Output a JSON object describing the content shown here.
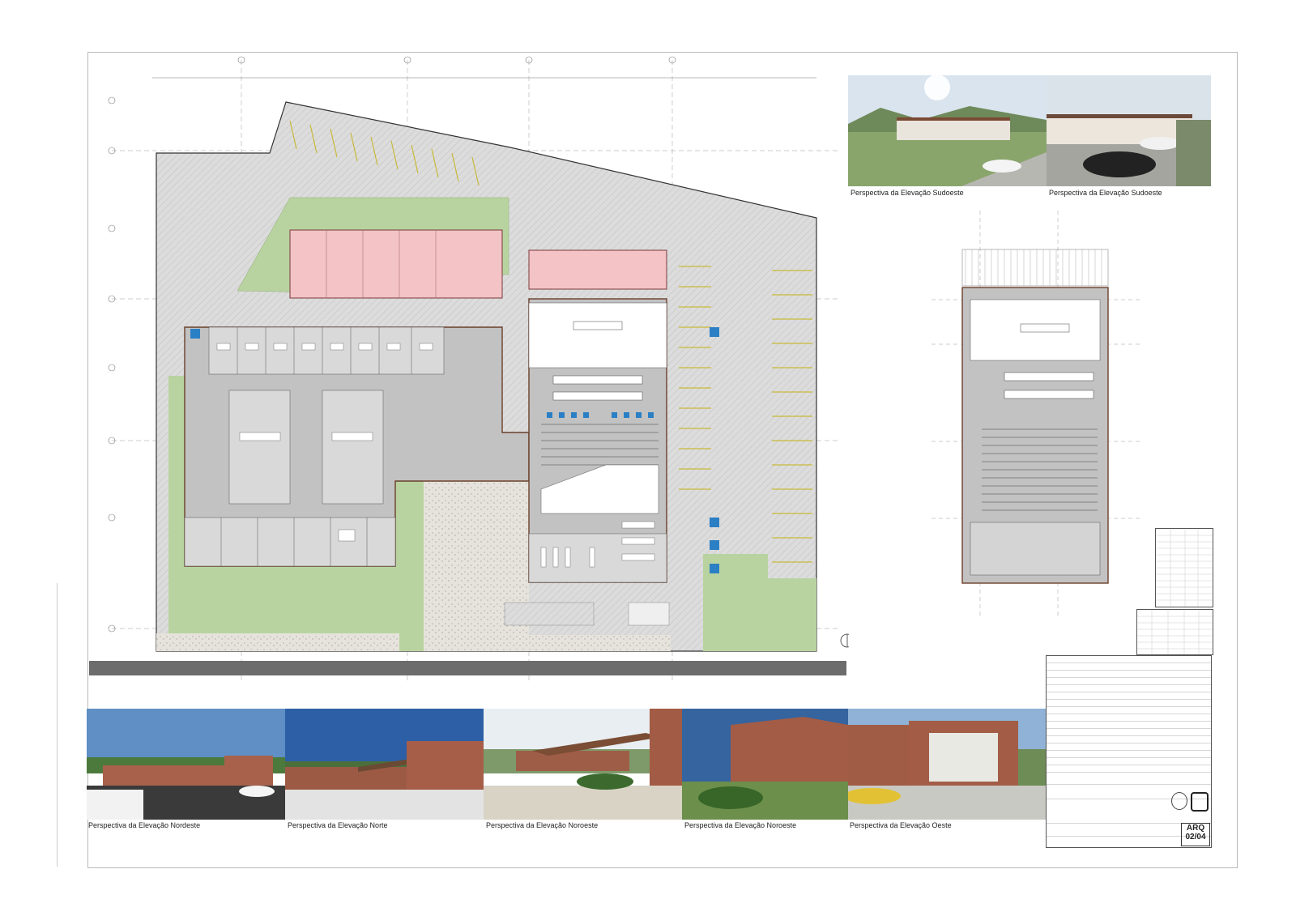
{
  "perspectives_top": [
    {
      "caption": "Perspectiva da Elevação Sudoeste"
    },
    {
      "caption": "Perspectiva da Elevação Sudoeste"
    }
  ],
  "perspectives_bottom": [
    {
      "caption": "Perspectiva da Elevação Nordeste"
    },
    {
      "caption": "Perspectiva da Elevação Norte"
    },
    {
      "caption": "Perspectiva da Elevação Noroeste"
    },
    {
      "caption": "Perspectiva da Elevação Noroeste"
    },
    {
      "caption": "Perspectiva da Elevação Oeste"
    }
  ],
  "title_block": {
    "sheet_code": "ARQ",
    "sheet_number": "02/04"
  },
  "colors": {
    "paving": "#d8d8d8",
    "green": "#b9d3a0",
    "pink": "#f3c3c6",
    "road": "#6c6c6c",
    "interior_gray": "#c2c2c2",
    "accessible_blue": "#2b7fc5"
  }
}
